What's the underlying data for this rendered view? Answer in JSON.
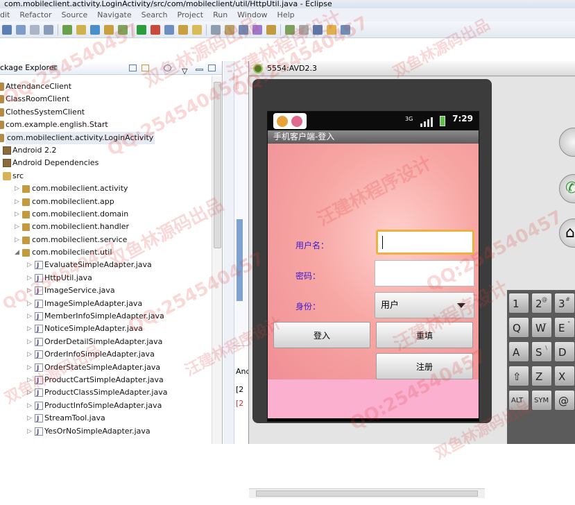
{
  "window": {
    "title": "com.mobileclient.activity.LoginActivity/src/com/mobileclient/util/HttpUtil.java - Eclipse"
  },
  "menu": [
    "dit",
    "Refactor",
    "Source",
    "Navigate",
    "Search",
    "Project",
    "Run",
    "Window",
    "Help"
  ],
  "package_explorer": {
    "title": "ckage Explorer",
    "tree": [
      {
        "label": "AttendanceClient",
        "depth": 0,
        "type": "project",
        "twisty": ""
      },
      {
        "label": "ClassRoomClient",
        "depth": 0,
        "type": "project",
        "twisty": ""
      },
      {
        "label": "ClothesSystemClient",
        "depth": 0,
        "type": "project",
        "twisty": ""
      },
      {
        "label": "com.example.english.Start",
        "depth": 0,
        "type": "project",
        "twisty": ""
      },
      {
        "label": "com.mobileclient.activity.LoginActivity",
        "depth": 0,
        "type": "project",
        "twisty": "",
        "selected": true
      },
      {
        "label": "Android 2.2",
        "depth": 1,
        "type": "library",
        "twisty": ""
      },
      {
        "label": "Android Dependencies",
        "depth": 1,
        "type": "library",
        "twisty": ""
      },
      {
        "label": "src",
        "depth": 1,
        "type": "src",
        "twisty": ""
      },
      {
        "label": "com.mobileclient.activity",
        "depth": 2,
        "type": "package",
        "twisty": "▷"
      },
      {
        "label": "com.mobileclient.app",
        "depth": 2,
        "type": "package",
        "twisty": "▷"
      },
      {
        "label": "com.mobileclient.domain",
        "depth": 2,
        "type": "package",
        "twisty": "▷"
      },
      {
        "label": "com.mobileclient.handler",
        "depth": 2,
        "type": "package",
        "twisty": "▷"
      },
      {
        "label": "com.mobileclient.service",
        "depth": 2,
        "type": "package",
        "twisty": "▷"
      },
      {
        "label": "com.mobileclient.util",
        "depth": 2,
        "type": "package",
        "twisty": "◢"
      },
      {
        "label": "EvaluateSimpleAdapter.java",
        "depth": 3,
        "type": "java",
        "twisty": "▷"
      },
      {
        "label": "HttpUtil.java",
        "depth": 3,
        "type": "java",
        "twisty": "▷"
      },
      {
        "label": "ImageService.java",
        "depth": 3,
        "type": "java",
        "twisty": "▷"
      },
      {
        "label": "ImageSimpleAdapter.java",
        "depth": 3,
        "type": "java",
        "twisty": "▷"
      },
      {
        "label": "MemberInfoSimpleAdapter.java",
        "depth": 3,
        "type": "java",
        "twisty": "▷"
      },
      {
        "label": "NoticeSimpleAdapter.java",
        "depth": 3,
        "type": "java",
        "twisty": "▷"
      },
      {
        "label": "OrderDetailSimpleAdapter.java",
        "depth": 3,
        "type": "java",
        "twisty": "▷"
      },
      {
        "label": "OrderInfoSimpleAdapter.java",
        "depth": 3,
        "type": "java",
        "twisty": "▷"
      },
      {
        "label": "OrderStateSimpleAdapter.java",
        "depth": 3,
        "type": "java",
        "twisty": "▷"
      },
      {
        "label": "ProductCartSimpleAdapter.java",
        "depth": 3,
        "type": "java",
        "twisty": "▷"
      },
      {
        "label": "ProductClassSimpleAdapter.java",
        "depth": 3,
        "type": "java",
        "twisty": "▷"
      },
      {
        "label": "ProductInfoSimpleAdapter.java",
        "depth": 3,
        "type": "java",
        "twisty": "▷"
      },
      {
        "label": "StreamTool.java",
        "depth": 3,
        "type": "java",
        "twisty": "▷"
      },
      {
        "label": "YesOrNoSimpleAdapter.java",
        "depth": 3,
        "type": "java",
        "twisty": "▷"
      }
    ]
  },
  "console_fragment": {
    "tab": "And",
    "line1": "[2",
    "line2": "[2"
  },
  "emulator": {
    "window_title": "5554:AVD2.3",
    "status": {
      "clock": "7:29",
      "network": "3G"
    },
    "app_title": "手机客户端-登入",
    "form": {
      "username_label": "用户名：",
      "username_value": "",
      "password_label": "密码：",
      "role_label": "身份：",
      "role_value": "用户",
      "login_button": "登入",
      "reset_button": "重填",
      "register_button": "注册"
    },
    "keyboard": [
      {
        "label": "1",
        "alt": ""
      },
      {
        "label": "2",
        "alt": "@"
      },
      {
        "label": "3",
        "alt": "#"
      },
      {
        "label": "Q",
        "alt": ""
      },
      {
        "label": "W",
        "alt": "~"
      },
      {
        "label": "E",
        "alt": "\""
      },
      {
        "label": "A",
        "alt": ""
      },
      {
        "label": "S",
        "alt": "\\"
      },
      {
        "label": "D",
        "alt": ""
      },
      {
        "label": "⇧",
        "alt": ""
      },
      {
        "label": "Z",
        "alt": ""
      },
      {
        "label": "X",
        "alt": ""
      },
      {
        "label": "ALT",
        "alt": ""
      },
      {
        "label": "SYM",
        "alt": ""
      },
      {
        "label": "@",
        "alt": ""
      }
    ]
  },
  "watermarks": [
    "QQ:254540457",
    "汪建林程序设计",
    "双鱼林源码出品"
  ],
  "colors": {
    "form_label": "#3b18d4",
    "username_focus": "#f0b040",
    "app_bg": "#f7a7a4",
    "footer_pink": "#fbb0d0",
    "watermark": "#e13c3c"
  }
}
